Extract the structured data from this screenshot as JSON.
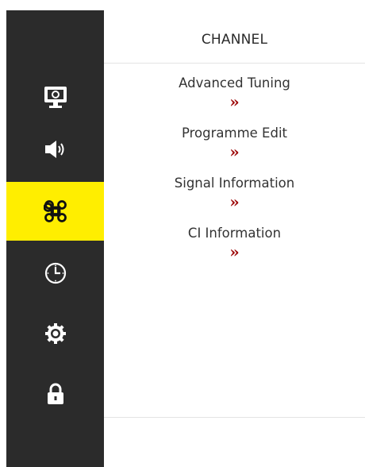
{
  "header": {
    "title": "CHANNEL"
  },
  "sidebar": {
    "items": [
      {
        "icon": "monitor-icon",
        "active": false
      },
      {
        "icon": "speaker-icon",
        "active": false
      },
      {
        "icon": "command-icon",
        "active": true
      },
      {
        "icon": "clock-icon",
        "active": false
      },
      {
        "icon": "gear-icon",
        "active": false
      },
      {
        "icon": "lock-icon",
        "active": false
      }
    ],
    "active_color": "#ffee00",
    "background": "#2b2b2b"
  },
  "menu": {
    "items": [
      {
        "label": "Advanced Tuning",
        "arrow": "»"
      },
      {
        "label": "Programme Edit",
        "arrow": "»"
      },
      {
        "label": "Signal Information",
        "arrow": "»"
      },
      {
        "label": "CI Information",
        "arrow": "»"
      }
    ],
    "arrow_color": "#9e0b0b"
  }
}
